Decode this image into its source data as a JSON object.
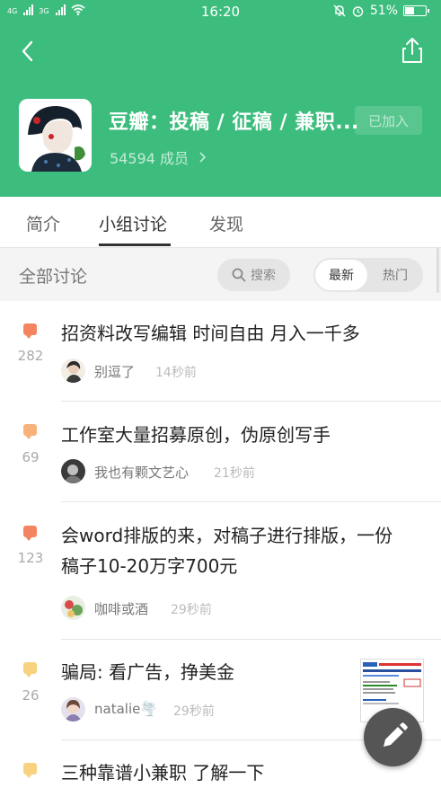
{
  "status_bar": {
    "network_1": "4G",
    "network_2": "3G",
    "time": "16:20",
    "battery": "51%",
    "battery_level": 0.51
  },
  "group": {
    "title": "豆瓣：投稿 / 征稿 / 兼职...",
    "members": "54594 成员",
    "join_label": "已加入",
    "accent_color": "#3dbd7d"
  },
  "tabs": [
    {
      "label": "简介"
    },
    {
      "label": "小组讨论"
    },
    {
      "label": "发现"
    }
  ],
  "filter": {
    "all_label": "全部讨论",
    "search_label": "搜索",
    "sort_latest": "最新",
    "sort_hot": "热门"
  },
  "posts": [
    {
      "title": "招资料改写编辑 时间自由 月入一千多",
      "count": "282",
      "user": "别逗了",
      "ago": "14秒前",
      "bubble_color": "#f4845f"
    },
    {
      "title": "工作室大量招募原创，伪原创写手",
      "count": "69",
      "user": "我也有颗文艺心",
      "ago": "21秒前",
      "bubble_color": "#f7b27a"
    },
    {
      "title": "会word排版的来，对稿子进行排版，一份",
      "title_line2": "稿子10-20万字700元",
      "count": "123",
      "user": "咖啡或酒",
      "ago": "29秒前",
      "bubble_color": "#f4845f"
    },
    {
      "title": "骗局: 看广告，挣美金",
      "count": "26",
      "user": "natalie🌪️",
      "ago": "29秒前",
      "bubble_color": "#f8d27e"
    },
    {
      "title": "三种靠谱小兼职 了解一下",
      "count": "",
      "user": "",
      "ago": "",
      "bubble_color": "#f8d27e"
    }
  ]
}
